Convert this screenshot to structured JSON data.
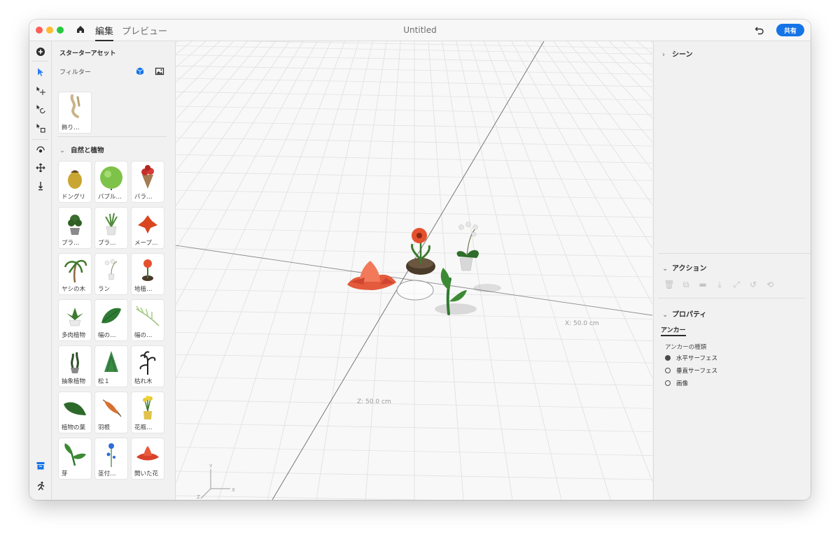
{
  "titlebar": {
    "tabs": [
      {
        "label": "編集",
        "active": true
      },
      {
        "label": "プレビュー",
        "active": false
      }
    ],
    "document_title": "Untitled",
    "share_label": "共有"
  },
  "tool_rail": {
    "tools": [
      "add-icon",
      "select-arrow-icon",
      "move-icon",
      "rotate-icon",
      "scale-icon",
      "transform-icon",
      "drop-icon",
      "align-icon",
      "asset-library-icon",
      "run-icon"
    ]
  },
  "assets": {
    "title": "スターターアセット",
    "filter_label": "フィルター",
    "previous_item": "飾り…",
    "section_title": "自然と植物",
    "items": [
      {
        "label": "ドングリ"
      },
      {
        "label": "バブル…"
      },
      {
        "label": "バラ…"
      },
      {
        "label": "プラ…"
      },
      {
        "label": "プラ…"
      },
      {
        "label": "メープ…"
      },
      {
        "label": "ヤシの木"
      },
      {
        "label": "ラン"
      },
      {
        "label": "地植…"
      },
      {
        "label": "多肉植物"
      },
      {
        "label": "幅の…"
      },
      {
        "label": "幅の…"
      },
      {
        "label": "抽象植物"
      },
      {
        "label": "松１"
      },
      {
        "label": "枯れ木"
      },
      {
        "label": "植物の葉"
      },
      {
        "label": "羽根"
      },
      {
        "label": "花瓶…"
      },
      {
        "label": "芽"
      },
      {
        "label": "茎付…"
      },
      {
        "label": "開いた花"
      }
    ]
  },
  "viewport": {
    "x_axis_label": "X: 50.0 cm",
    "z_axis_label": "Z: 50.0 cm",
    "gizmo": {
      "x": "X",
      "y": "Y",
      "z": "Z"
    }
  },
  "properties": {
    "scene_label": "シーン",
    "action_label": "アクション",
    "property_label": "プロパティ",
    "anchor_tab": "アンカー",
    "anchor_kind_label": "アンカーの種類",
    "anchor_options": [
      {
        "label": "水平サーフェス",
        "checked": true
      },
      {
        "label": "垂直サーフェス",
        "checked": false
      },
      {
        "label": "画像",
        "checked": false
      }
    ]
  },
  "colors": {
    "accent": "#1473e6",
    "select_blue": "#2d7ff9"
  }
}
